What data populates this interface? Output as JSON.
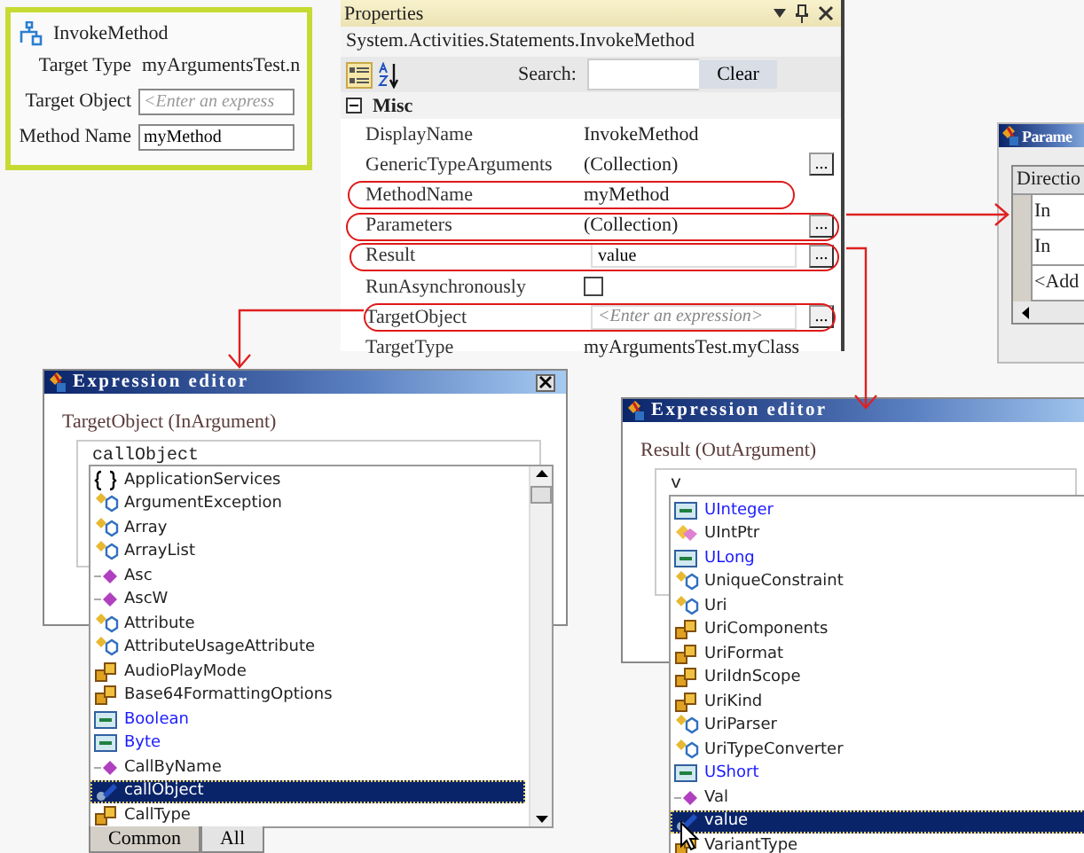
{
  "activity": {
    "title": "InvokeMethod",
    "fields": [
      {
        "label": "Target Type",
        "kind": "text",
        "value": "myArgumentsTest.n"
      },
      {
        "label": "Target Object",
        "kind": "input",
        "placeholder": "<Enter an express"
      },
      {
        "label": "Method Name",
        "kind": "input",
        "value": "myMethod"
      }
    ]
  },
  "properties": {
    "title": "Properties",
    "subtitle": "System.Activities.Statements.InvokeMethod",
    "search_label": "Search:",
    "clear_button": "Clear",
    "category": {
      "label": "Misc",
      "expanded": true
    },
    "rows": [
      {
        "name": "DisplayName",
        "kind": "text",
        "value": "InvokeMethod",
        "circled": false
      },
      {
        "name": "GenericTypeArguments",
        "kind": "text",
        "value": "(Collection)",
        "button": "...",
        "circled": false
      },
      {
        "name": "MethodName",
        "kind": "text",
        "value": "myMethod",
        "circled": true
      },
      {
        "name": "Parameters",
        "kind": "text",
        "value": "(Collection)",
        "button": "...",
        "circled": true
      },
      {
        "name": "Result",
        "kind": "input",
        "value": "value",
        "button": "...",
        "circled": true
      },
      {
        "name": "RunAsynchronously",
        "kind": "checkbox",
        "checked": false,
        "circled": false
      },
      {
        "name": "TargetObject",
        "kind": "input",
        "placeholder": "<Enter an expression>",
        "button": "...",
        "circled": true
      },
      {
        "name": "TargetType",
        "kind": "text",
        "value": "myArgumentsTest.myClass",
        "circled": false
      }
    ]
  },
  "parameters_window": {
    "title": "Parame",
    "column": "Directio",
    "rows": [
      "In",
      "In",
      "<Add"
    ]
  },
  "editors": [
    {
      "title": "Expression editor",
      "argument": "TargetObject (InArgument)",
      "input": "callObject",
      "close": true,
      "items": [
        {
          "text": "ApplicationServices",
          "kind": "namespace",
          "selected": false
        },
        {
          "text": "ArgumentException",
          "kind": "class",
          "selected": false
        },
        {
          "text": "Array",
          "kind": "class",
          "selected": false
        },
        {
          "text": "ArrayList",
          "kind": "class",
          "selected": false
        },
        {
          "text": "Asc",
          "kind": "method",
          "selected": false
        },
        {
          "text": "AscW",
          "kind": "method",
          "selected": false
        },
        {
          "text": "Attribute",
          "kind": "class",
          "selected": false
        },
        {
          "text": "AttributeUsageAttribute",
          "kind": "class",
          "selected": false
        },
        {
          "text": "AudioPlayMode",
          "kind": "enum",
          "selected": false
        },
        {
          "text": "Base64FormattingOptions",
          "kind": "enum",
          "selected": false
        },
        {
          "text": "Boolean",
          "kind": "keyword",
          "selected": false
        },
        {
          "text": "Byte",
          "kind": "keyword",
          "selected": false
        },
        {
          "text": "CallByName",
          "kind": "method",
          "selected": false
        },
        {
          "text": "callObject",
          "kind": "variable",
          "selected": true
        },
        {
          "text": "CallType",
          "kind": "enum",
          "selected": false
        }
      ],
      "tabs": [
        {
          "label": "Common",
          "selected": true
        },
        {
          "label": "All",
          "selected": false
        }
      ]
    },
    {
      "title": "Expression editor",
      "argument": "Result (OutArgument)",
      "input": "v",
      "close": false,
      "items": [
        {
          "text": "UInteger",
          "kind": "keyword",
          "selected": false
        },
        {
          "text": "UIntPtr",
          "kind": "struct",
          "selected": false
        },
        {
          "text": "ULong",
          "kind": "keyword",
          "selected": false
        },
        {
          "text": "UniqueConstraint",
          "kind": "class",
          "selected": false
        },
        {
          "text": "Uri",
          "kind": "class",
          "selected": false
        },
        {
          "text": "UriComponents",
          "kind": "enum",
          "selected": false
        },
        {
          "text": "UriFormat",
          "kind": "enum",
          "selected": false
        },
        {
          "text": "UriIdnScope",
          "kind": "enum",
          "selected": false
        },
        {
          "text": "UriKind",
          "kind": "enum",
          "selected": false
        },
        {
          "text": "UriParser",
          "kind": "class",
          "selected": false
        },
        {
          "text": "UriTypeConverter",
          "kind": "class",
          "selected": false
        },
        {
          "text": "UShort",
          "kind": "keyword",
          "selected": false
        },
        {
          "text": "Val",
          "kind": "method",
          "selected": false
        },
        {
          "text": "value",
          "kind": "variable",
          "selected": true
        },
        {
          "text": "VariantType",
          "kind": "enum",
          "selected": false
        }
      ]
    }
  ]
}
